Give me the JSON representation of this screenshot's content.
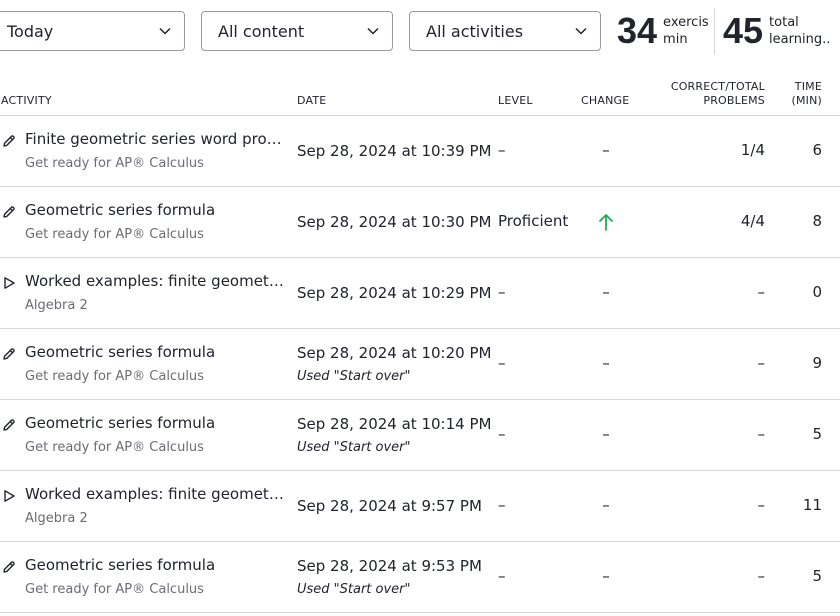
{
  "filters": {
    "time": "Today",
    "content": "All content",
    "activity": "All activities"
  },
  "stats": {
    "exercise_minutes": {
      "value": "34",
      "label1": "exercis",
      "label2": "min"
    },
    "learning_minutes": {
      "value": "45",
      "label1": "total",
      "label2": "learning..."
    }
  },
  "columns": {
    "activity": "ACTIVITY",
    "date": "DATE",
    "level": "LEVEL",
    "change": "CHANGE",
    "correct_line1": "CORRECT/TOTAL",
    "correct_line2": "PROBLEMS",
    "time_line1": "TIME",
    "time_line2": "(MIN)"
  },
  "rows": [
    {
      "icon": "pencil-icon",
      "title": "Finite geometric series word probl…",
      "course": "Get ready for AP® Calculus",
      "date": "Sep 28, 2024 at 10:39 PM",
      "note": "",
      "level": "–",
      "change": "–",
      "correct": "1/4",
      "time": "6"
    },
    {
      "icon": "pencil-icon",
      "title": "Geometric series formula",
      "course": "Get ready for AP® Calculus",
      "date": "Sep 28, 2024 at 10:30 PM",
      "note": "",
      "level": "Proficient",
      "change": "up-arrow-icon",
      "correct": "4/4",
      "time": "8"
    },
    {
      "icon": "play-icon",
      "title": "Worked examples: finite geometric…",
      "course": "Algebra 2",
      "date": "Sep 28, 2024 at 10:29 PM",
      "note": "",
      "level": "–",
      "change": "–",
      "correct": "–",
      "time": "0"
    },
    {
      "icon": "pencil-icon",
      "title": "Geometric series formula",
      "course": "Get ready for AP® Calculus",
      "date": "Sep 28, 2024 at 10:20 PM",
      "note": "Used \"Start over\"",
      "level": "–",
      "change": "–",
      "correct": "–",
      "time": "9"
    },
    {
      "icon": "pencil-icon",
      "title": "Geometric series formula",
      "course": "Get ready for AP® Calculus",
      "date": "Sep 28, 2024 at 10:14 PM",
      "note": "Used \"Start over\"",
      "level": "–",
      "change": "–",
      "correct": "–",
      "time": "5"
    },
    {
      "icon": "play-icon",
      "title": "Worked examples: finite geometric…",
      "course": "Algebra 2",
      "date": "Sep 28, 2024 at 9:57 PM",
      "note": "",
      "level": "–",
      "change": "–",
      "correct": "–",
      "time": "11"
    },
    {
      "icon": "pencil-icon",
      "title": "Geometric series formula",
      "course": "Get ready for AP® Calculus",
      "date": "Sep 28, 2024 at 9:53 PM",
      "note": "Used \"Start over\"",
      "level": "–",
      "change": "–",
      "correct": "–",
      "time": "5"
    }
  ],
  "colors": {
    "text": "#21242c",
    "muted": "#6b6d73",
    "border": "#d6d8da",
    "up_arrow": "#1fab54"
  }
}
